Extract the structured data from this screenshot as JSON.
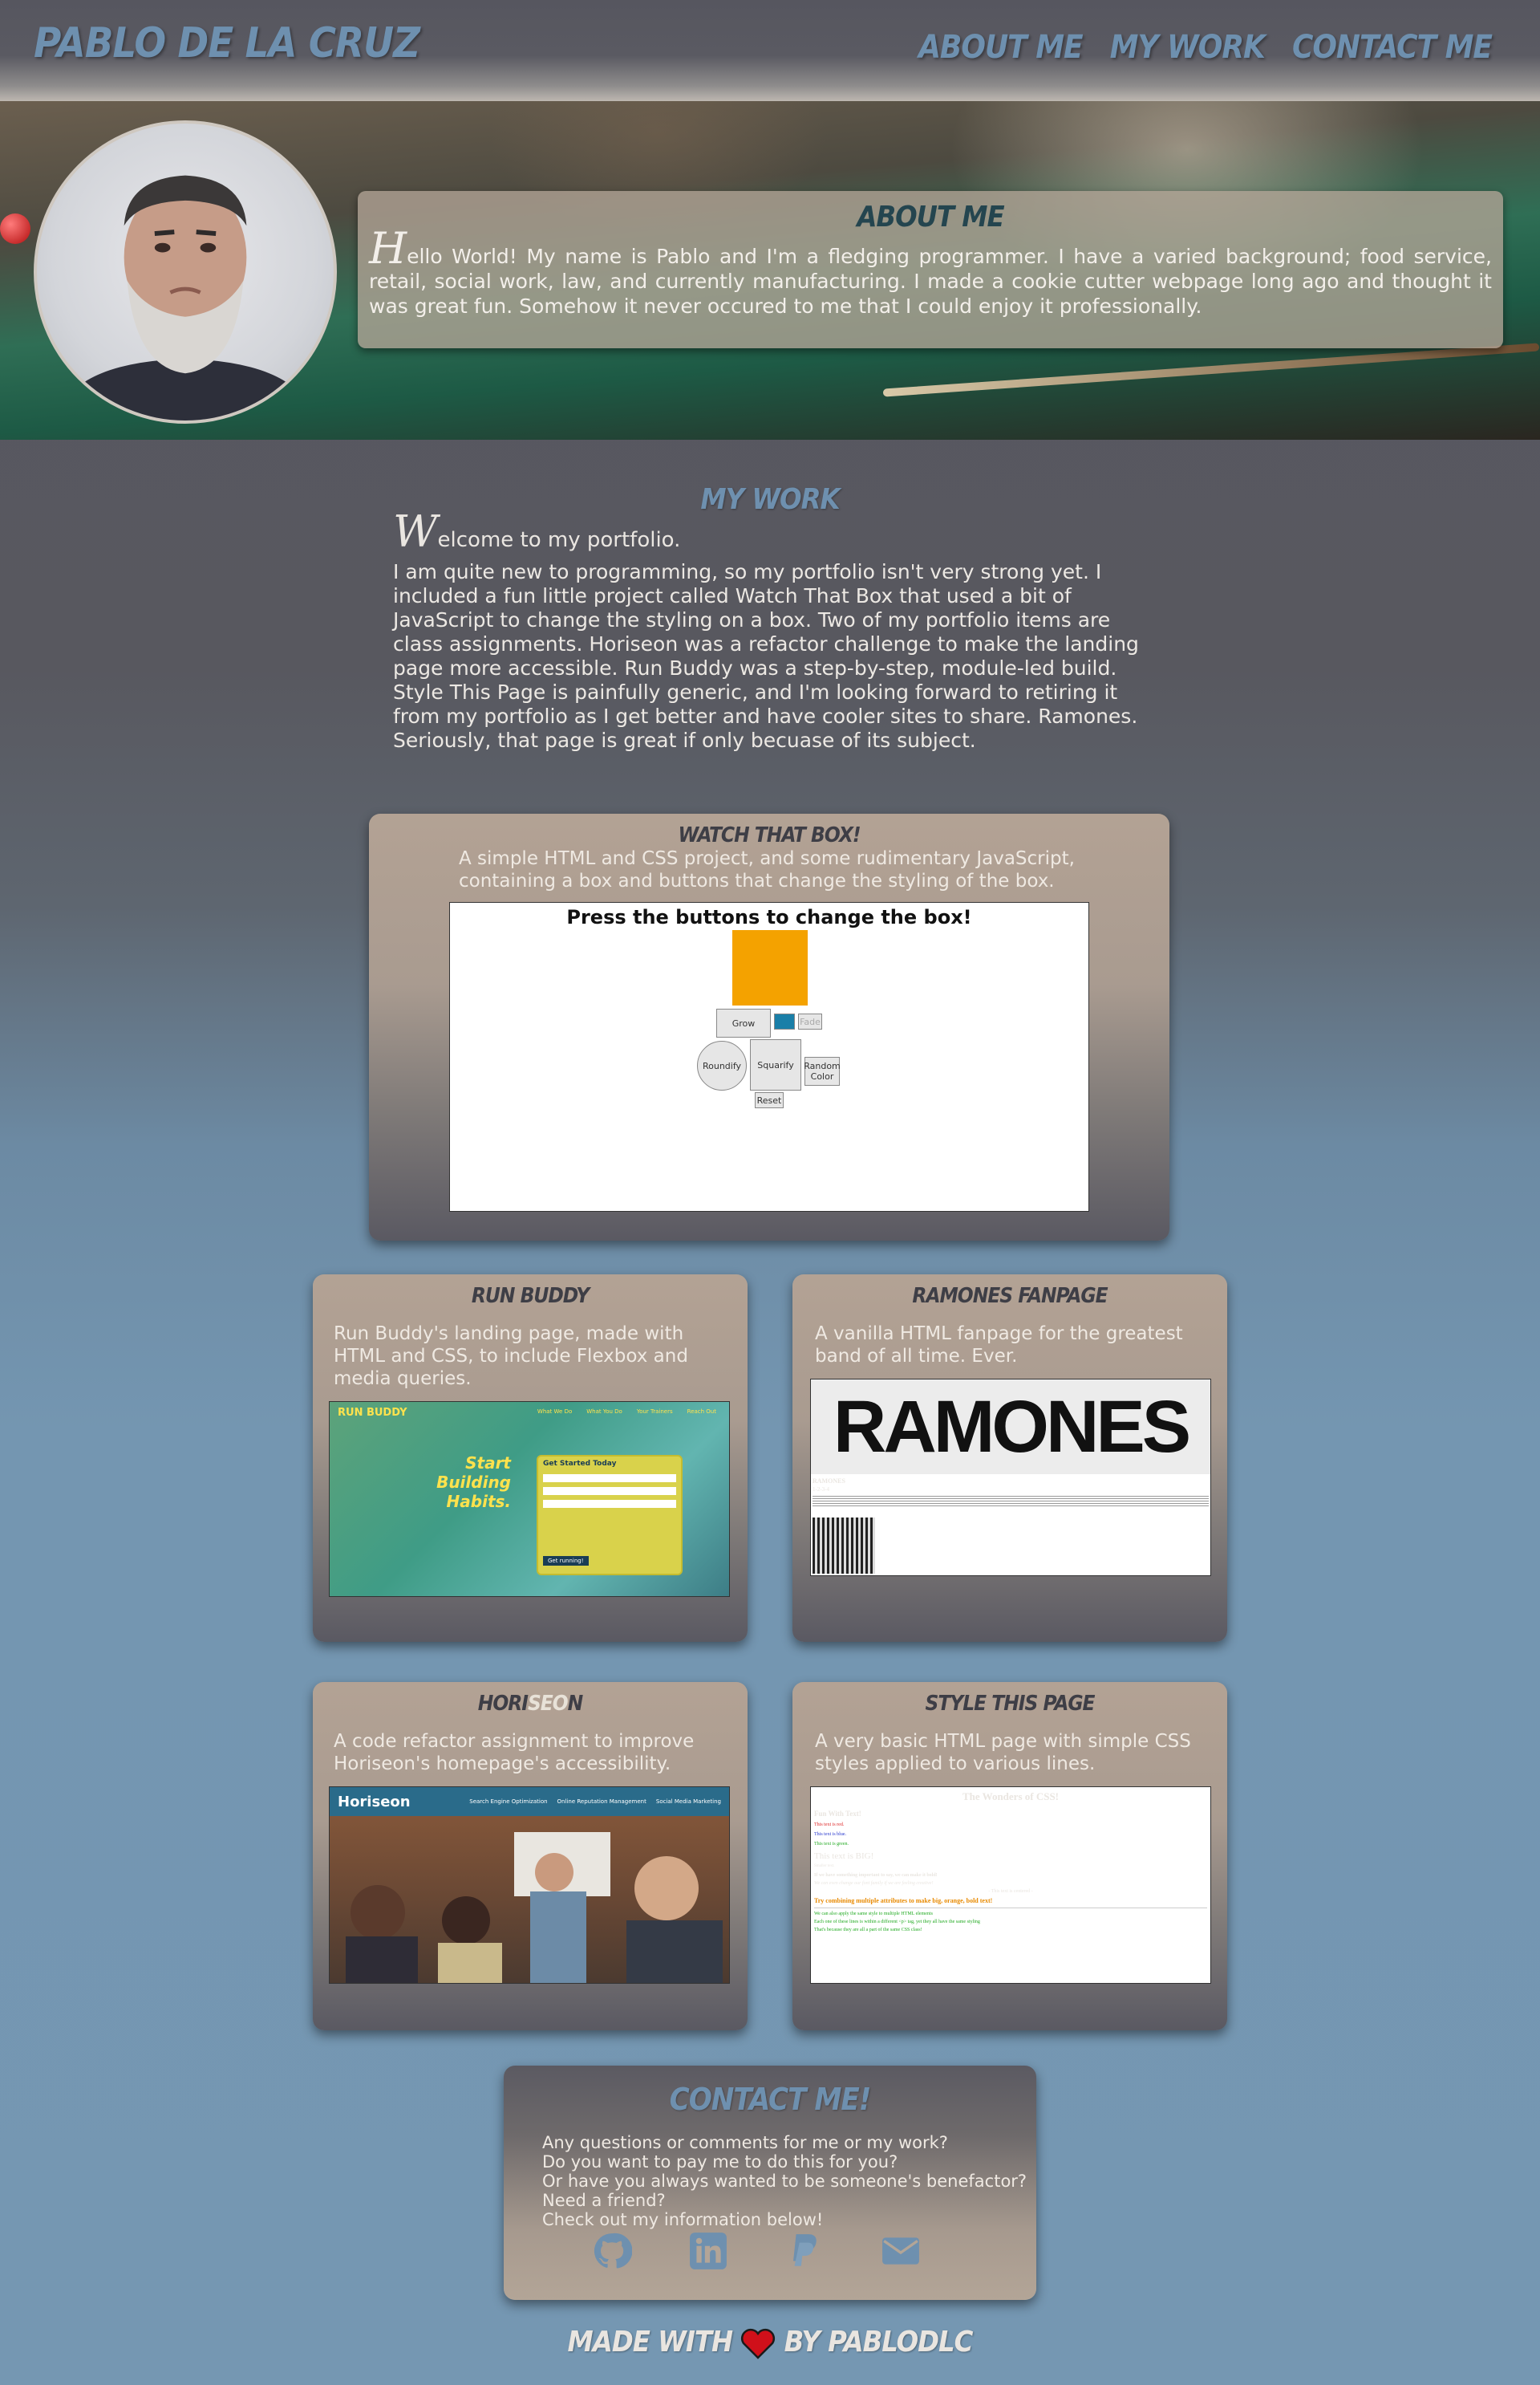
{
  "header": {
    "site_title": "PABLO DE LA CRUZ",
    "nav": [
      "ABOUT ME",
      "MY WORK",
      "CONTACT ME"
    ]
  },
  "about": {
    "title": "ABOUT ME",
    "dropcap": "H",
    "text": "ello World! My name is Pablo and I'm a fledging programmer. I have a varied background; food service, retail, social work, law, and currently manufacturing. I made a cookie cutter webpage long ago and thought it was great fun. Somehow it never occured to me that I could enjoy it professionally."
  },
  "work": {
    "title": "MY WORK",
    "dropcap": "W",
    "welcome": "elcome to my portfolio.",
    "body": "I am quite new to programming, so my portfolio isn't very strong yet. I included a fun little project called Watch That Box that used a bit of JavaScript to change the styling on a box. Two of my portfolio items are class assignments. Horiseon was a refactor challenge to make the landing page more accessible. Run Buddy was a step-by-step, module-led build. Style This Page is painfully generic, and I'm looking forward to retiring it from my portfolio as I get better and have cooler sites to share. Ramones. Seriously, that page is great if only becuase of its subject."
  },
  "projects": {
    "watch": {
      "title": "WATCH THAT BOX!",
      "desc": "A simple HTML and CSS project, and some rudimentary JavaScript, containing a box and buttons that change the styling of the box.",
      "screen_heading": "Press the buttons to change the box!",
      "buttons": {
        "grow": "Grow",
        "blue": "Blue",
        "fade": "Fade",
        "roundify": "Roundify",
        "squarify": "Squarify",
        "random": "Random Color",
        "reset": "Reset"
      }
    },
    "runbuddy": {
      "title": "RUN BUDDY",
      "desc": "Run Buddy's landing page, made with HTML and CSS, to include Flexbox and media queries.",
      "logo": "RUN BUDDY",
      "nav": [
        "What We Do",
        "What You Do",
        "Your Trainers",
        "Reach Out"
      ],
      "headline": "Start Building Habits.",
      "form_title": "Get Started Today",
      "submit": "Get running!"
    },
    "ramones": {
      "title": "RAMONES FANPAGE",
      "desc": "A vanilla HTML fanpage for the greatest band of all time. Ever.",
      "banner": "RAMONES",
      "sub1": "RAMONES",
      "sub2": "1-2-3-4"
    },
    "horiseon": {
      "title_a": "HORI",
      "title_b": "SEO",
      "title_c": "N",
      "desc": "A code refactor assignment to improve Horiseon's homepage's accessibility.",
      "logo": "Horiseon",
      "nav": [
        "Search Engine Optimization",
        "Online Reputation Management",
        "Social Media Marketing"
      ]
    },
    "style": {
      "title": "STYLE THIS PAGE",
      "desc": "A very basic HTML page with simple CSS styles applied to various lines.",
      "heading": "The Wonders of CSS!",
      "fun": "Fun With Text!",
      "red": "This text is red.",
      "blue": "This text is blue.",
      "green": "This text is green.",
      "big": "This text is BIG!",
      "small": "Smaller text.",
      "bold": "If we have something important to say, we can make it bold!",
      "italic": "We can even change our font family if we are feeling creative!",
      "comment": "- This text is centered -",
      "orange": "Try combining multiple attributes to make big, orange, bold text!",
      "g1": "We can also apply the same style to multiple HTML elements",
      "g2": "Each one of these lines is within a different <p> tag, yet they all have the same styling",
      "g3": "That's because they are all a part of the same CSS class!"
    }
  },
  "contact": {
    "title": "CONTACT ME!",
    "lines": [
      "Any questions or comments for me or my work?",
      "Do you want to pay me to do this for you?",
      "Or have you always wanted to be someone's benefactor?",
      "Need a friend?",
      "Check out my information below!"
    ],
    "icons": [
      "github-icon",
      "linkedin-icon",
      "paypal-icon",
      "email-icon"
    ]
  },
  "footer": {
    "made_with": "MADE WITH",
    "by": "BY PABLODLC"
  },
  "colors": {
    "accent": "#6e90af",
    "card": "#b3a294",
    "watch_box": "#f4a200"
  }
}
